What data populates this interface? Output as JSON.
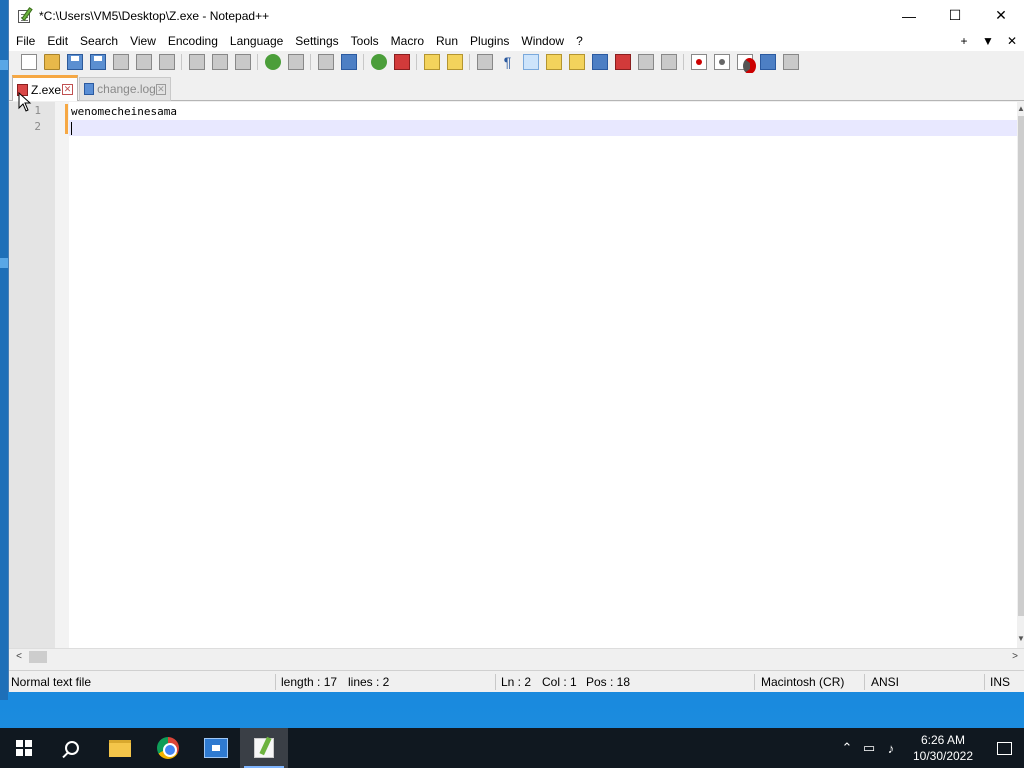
{
  "window": {
    "title": "*C:\\Users\\VM5\\Desktop\\Z.exe - Notepad++",
    "minimize": "—",
    "maximize": "☐",
    "close": "✕"
  },
  "menu": {
    "items": [
      "File",
      "Edit",
      "Search",
      "View",
      "Encoding",
      "Language",
      "Settings",
      "Tools",
      "Macro",
      "Run",
      "Plugins",
      "Window",
      "?"
    ],
    "right": [
      "+",
      "▼",
      "✕"
    ]
  },
  "tabs": [
    {
      "label": "Z.exe",
      "active": true,
      "icon": "unsaved-file-icon"
    },
    {
      "label": "change.log",
      "active": false,
      "icon": "saved-file-icon"
    }
  ],
  "editor": {
    "lines": [
      {
        "number": "1",
        "text": "wenomecheinesama"
      },
      {
        "number": "2",
        "text": ""
      }
    ]
  },
  "status": {
    "file_type": "Normal text file",
    "length": "length : 17",
    "lines": "lines : 2",
    "ln": "Ln : 2",
    "col": "Col : 1",
    "pos": "Pos : 18",
    "eol": "Macintosh (CR)",
    "encoding": "ANSI",
    "mode": "INS"
  },
  "taskbar": {
    "apps": [
      "start-button",
      "search-button",
      "file-explorer",
      "chrome",
      "app-box",
      "notepad-plus-plus"
    ],
    "tray": {
      "time": "6:26 AM",
      "date": "10/30/2022"
    }
  }
}
